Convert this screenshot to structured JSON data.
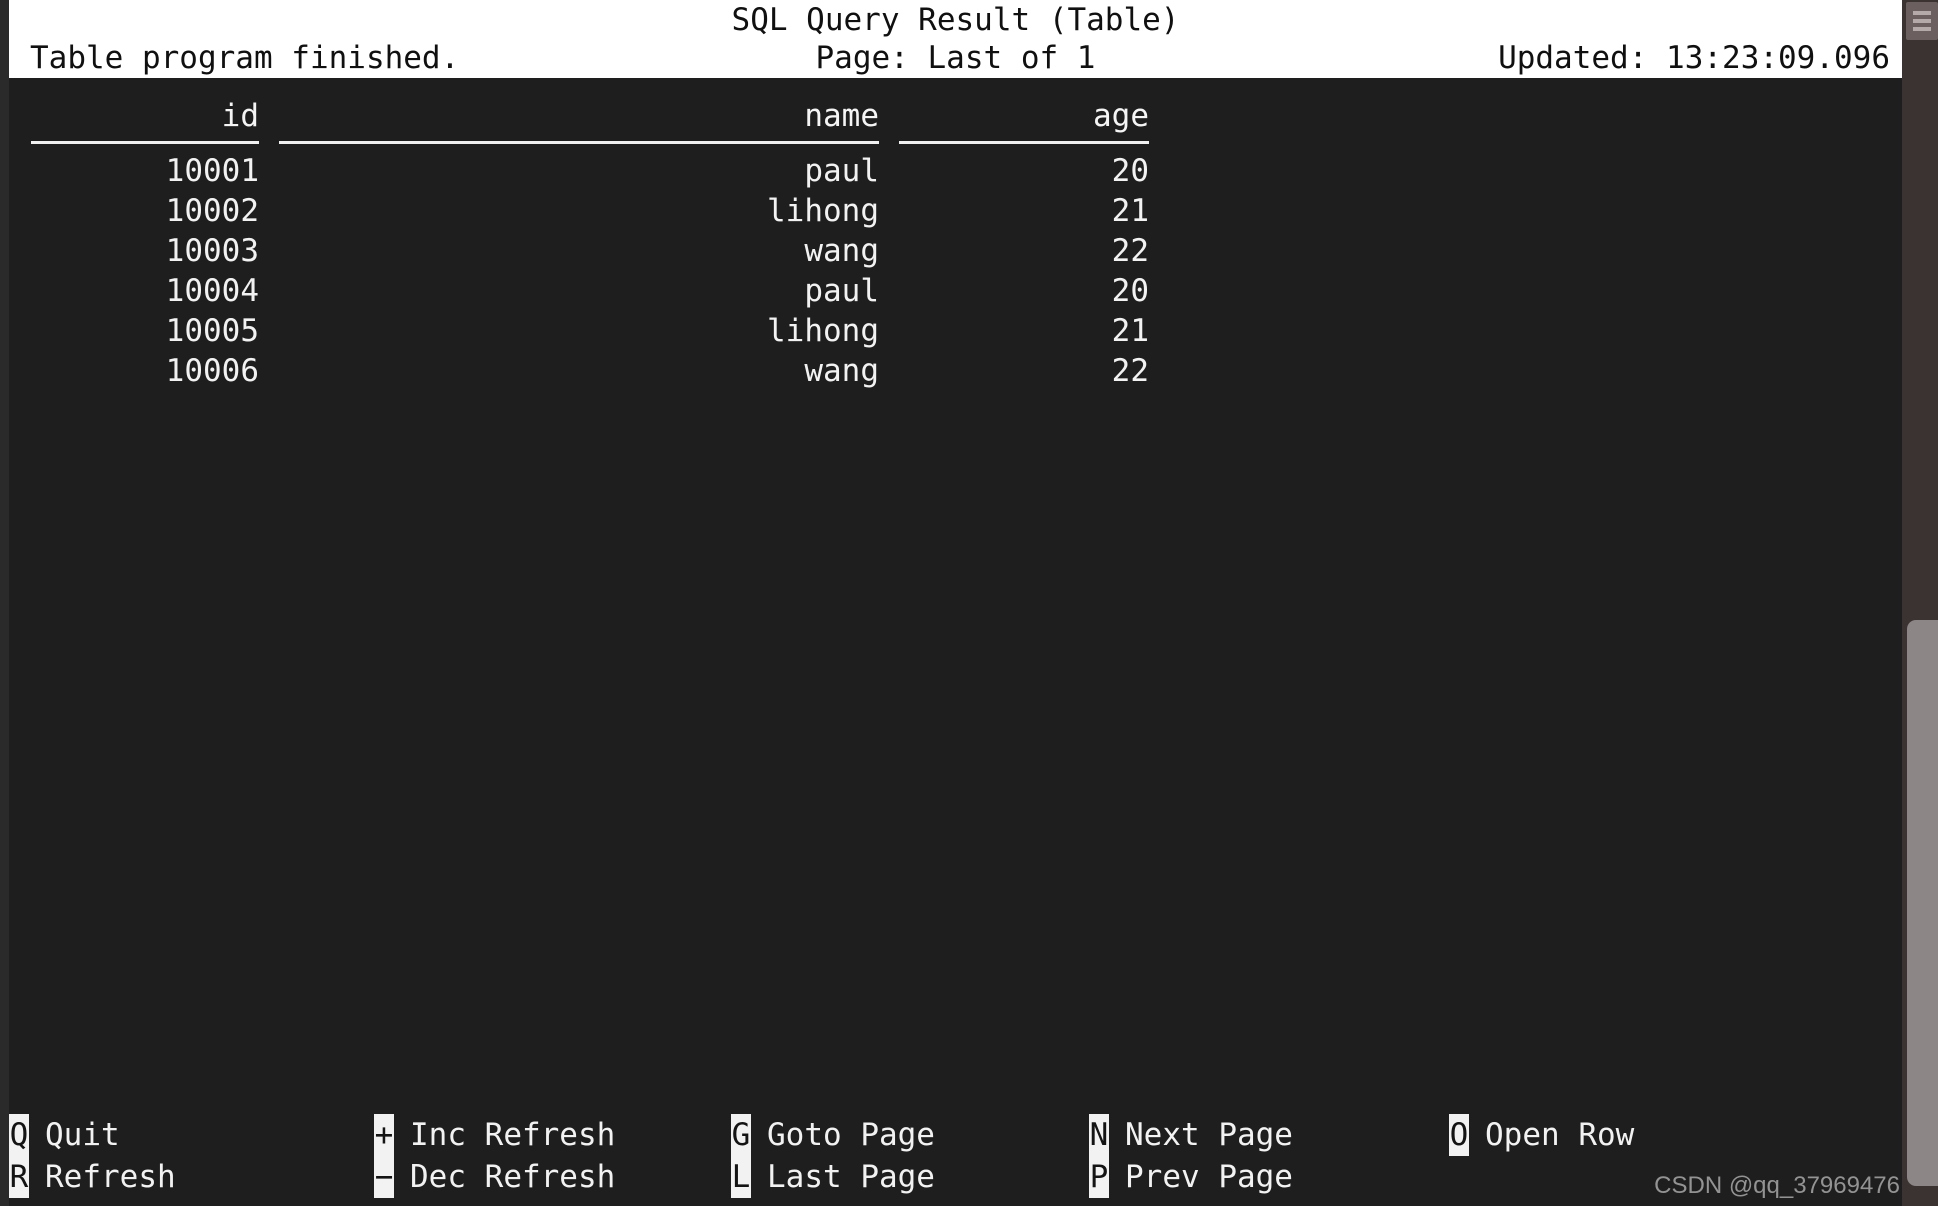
{
  "window": {
    "title": "SQL Query Result (Table)"
  },
  "status": {
    "message": "Table program finished.",
    "page": "Page: Last of 1",
    "updated": "Updated: 13:23:09.096"
  },
  "table": {
    "columns": [
      "id",
      "name",
      "age"
    ],
    "rows": [
      {
        "id": "10001",
        "name": "paul",
        "age": "20"
      },
      {
        "id": "10002",
        "name": "lihong",
        "age": "21"
      },
      {
        "id": "10003",
        "name": "wang",
        "age": "22"
      },
      {
        "id": "10004",
        "name": "paul",
        "age": "20"
      },
      {
        "id": "10005",
        "name": "lihong",
        "age": "21"
      },
      {
        "id": "10006",
        "name": "wang",
        "age": "22"
      }
    ]
  },
  "keybar": {
    "columns": [
      {
        "keys": [
          {
            "key": "Q",
            "label": "Quit"
          },
          {
            "key": "R",
            "label": "Refresh"
          }
        ]
      },
      {
        "keys": [
          {
            "key": "+",
            "label": "Inc Refresh"
          },
          {
            "key": "−",
            "label": "Dec Refresh"
          }
        ]
      },
      {
        "keys": [
          {
            "key": "G",
            "label": "Goto Page"
          },
          {
            "key": "L",
            "label": "Last Page"
          }
        ]
      },
      {
        "keys": [
          {
            "key": "N",
            "label": "Next Page"
          },
          {
            "key": "P",
            "label": "Prev Page"
          }
        ]
      },
      {
        "keys": [
          {
            "key": "O",
            "label": "Open Row"
          }
        ]
      }
    ]
  },
  "watermark": {
    "text": "CSDN @qq_37969476"
  },
  "colors": {
    "terminal_background": "#1e1e1e",
    "terminal_foreground": "#f2f2f2",
    "header_background": "#ffffff",
    "header_foreground": "#101010",
    "scrollbar_track": "#3b3232",
    "scrollbar_thumb": "#8c8686",
    "watermark": "#9d9d9d"
  }
}
